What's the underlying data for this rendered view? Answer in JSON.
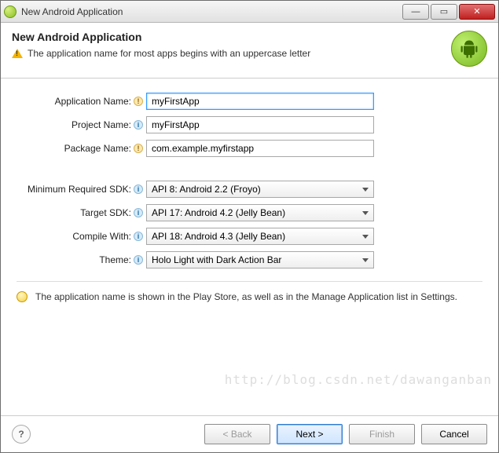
{
  "window": {
    "title": "New Android Application"
  },
  "header": {
    "dialog_title": "New Android Application",
    "warning_text": "The application name for most apps begins with an uppercase letter"
  },
  "form": {
    "app_name": {
      "label": "Application Name:",
      "value": "myFirstApp"
    },
    "project_name": {
      "label": "Project Name:",
      "value": "myFirstApp"
    },
    "package_name": {
      "label": "Package Name:",
      "value": "com.example.myfirstapp"
    },
    "min_sdk": {
      "label": "Minimum Required SDK:",
      "value": "API 8: Android 2.2 (Froyo)"
    },
    "target_sdk": {
      "label": "Target SDK:",
      "value": "API 17: Android 4.2 (Jelly Bean)"
    },
    "compile_with": {
      "label": "Compile With:",
      "value": "API 18: Android 4.3 (Jelly Bean)"
    },
    "theme": {
      "label": "Theme:",
      "value": "Holo Light with Dark Action Bar"
    }
  },
  "hint": "The application name is shown in the Play Store, as well as in the Manage Application list in Settings.",
  "footer": {
    "back": "< Back",
    "next": "Next >",
    "finish": "Finish",
    "cancel": "Cancel"
  },
  "watermark": "http://blog.csdn.net/dawanganban"
}
